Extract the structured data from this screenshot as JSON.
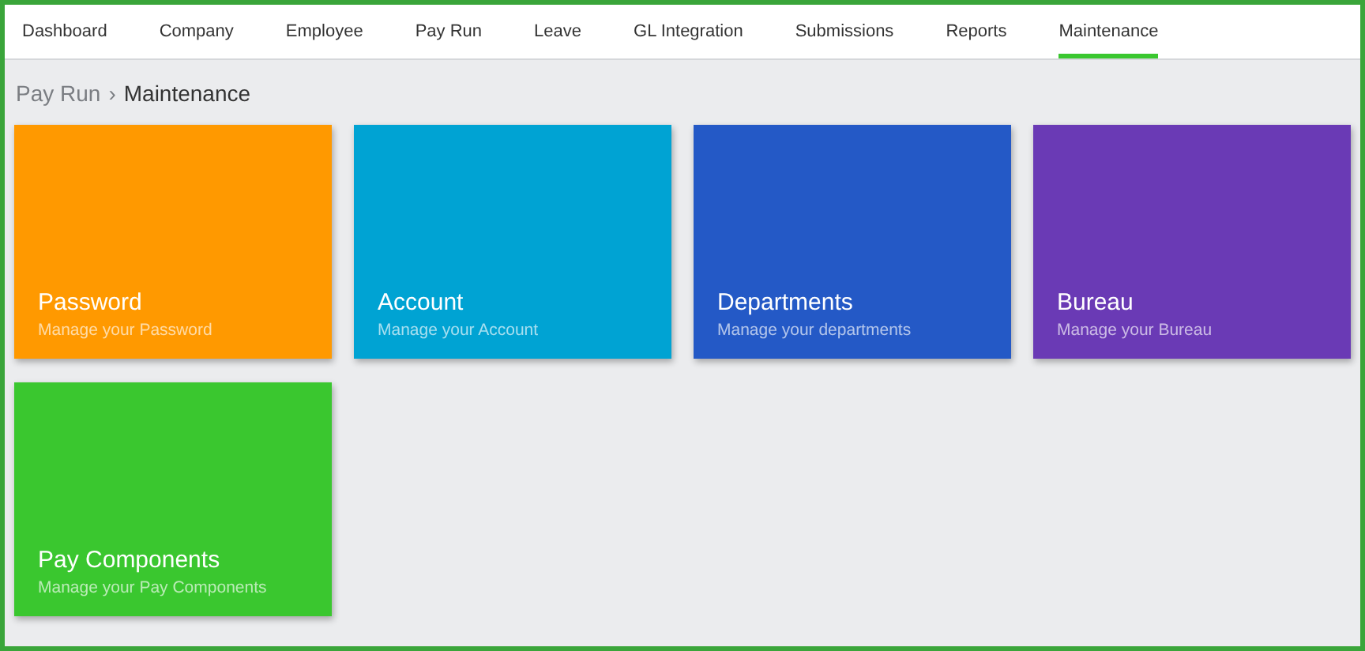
{
  "nav": {
    "tabs": [
      {
        "label": "Dashboard",
        "selected": false
      },
      {
        "label": "Company",
        "selected": false
      },
      {
        "label": "Employee",
        "selected": false
      },
      {
        "label": "Pay Run",
        "selected": false
      },
      {
        "label": "Leave",
        "selected": false
      },
      {
        "label": "GL Integration",
        "selected": false
      },
      {
        "label": "Submissions",
        "selected": false
      },
      {
        "label": "Reports",
        "selected": false
      },
      {
        "label": "Maintenance",
        "selected": true
      }
    ]
  },
  "breadcrumb": {
    "parent": "Pay Run",
    "separator": "›",
    "current": "Maintenance"
  },
  "tiles": [
    {
      "title": "Password",
      "subtitle": "Manage your Password",
      "color": "#ff9900"
    },
    {
      "title": "Account",
      "subtitle": "Manage your Account",
      "color": "#00a3d3"
    },
    {
      "title": "Departments",
      "subtitle": "Manage your departments",
      "color": "#2459c6"
    },
    {
      "title": "Bureau",
      "subtitle": "Manage your Bureau",
      "color": "#6a3ab5"
    },
    {
      "title": "Pay Components",
      "subtitle": "Manage your Pay Components",
      "color": "#3ac72f"
    }
  ]
}
